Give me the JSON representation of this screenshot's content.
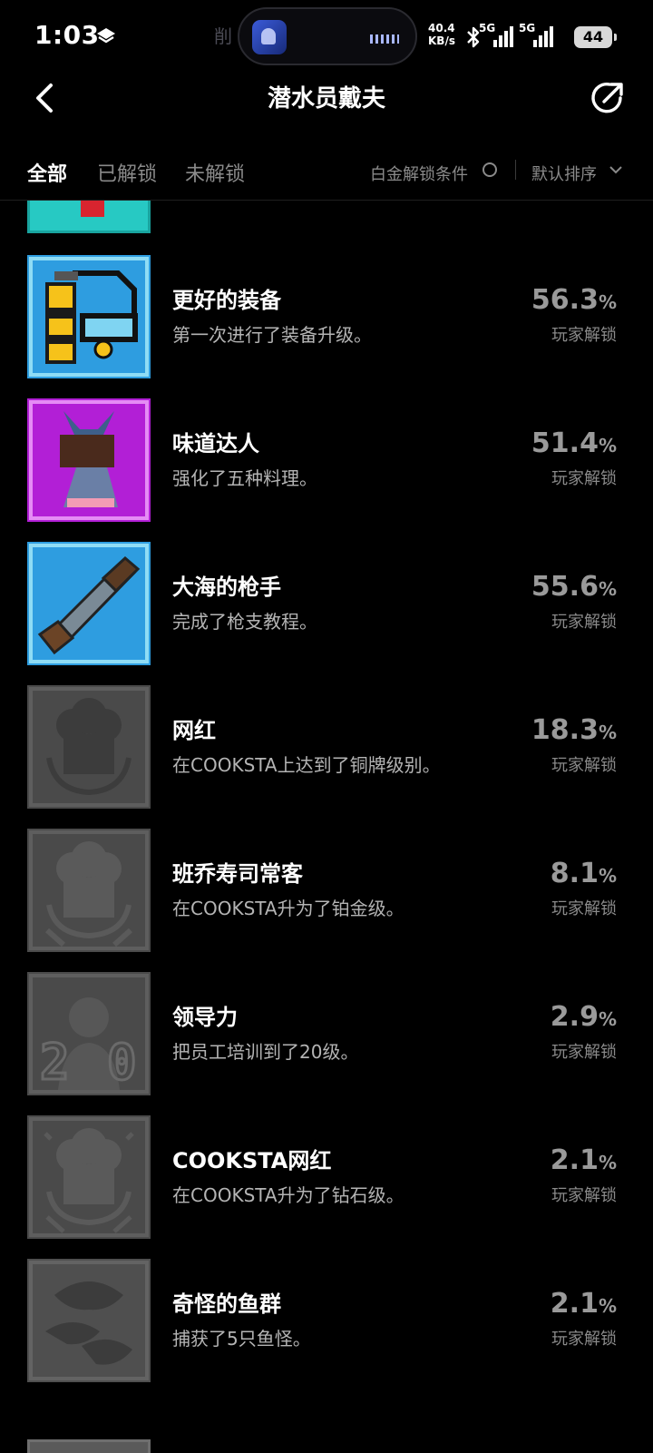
{
  "status_bar": {
    "time": "1:03",
    "net_speed_value": "40.4",
    "net_speed_unit": "KB/s",
    "sim1_label": "5G",
    "sim2_label": "5G",
    "battery": "44",
    "ghost_text": "削"
  },
  "header": {
    "title": "潜水员戴夫",
    "back_icon": "chevron-left-icon",
    "share_icon": "share-icon"
  },
  "tabs": [
    {
      "label": "全部",
      "active": true
    },
    {
      "label": "已解锁",
      "active": false
    },
    {
      "label": "未解锁",
      "active": false
    }
  ],
  "filter": {
    "platinum_condition": "白金解锁条件",
    "sort_label": "默认排序"
  },
  "achievements": [
    {
      "title": "更好的装备",
      "desc": "第一次进行了装备升级。",
      "percent": "56.3",
      "unit": "%",
      "sub": "玩家解锁",
      "unlocked": true,
      "icon": "scuba-gear-icon"
    },
    {
      "title": "味道达人",
      "desc": "强化了五种料理。",
      "percent": "51.4",
      "unit": "%",
      "sub": "玩家解锁",
      "unlocked": true,
      "icon": "sushi-dish-icon"
    },
    {
      "title": "大海的枪手",
      "desc": "完成了枪支教程。",
      "percent": "55.6",
      "unit": "%",
      "sub": "玩家解锁",
      "unlocked": true,
      "icon": "harpoon-gun-icon"
    },
    {
      "title": "网红",
      "desc": "在COOKSTA上达到了铜牌级别。",
      "percent": "18.3",
      "unit": "%",
      "sub": "玩家解锁",
      "unlocked": false,
      "icon": "chef-hat-bronze-icon"
    },
    {
      "title": "班乔寿司常客",
      "desc": "在COOKSTA升为了铂金级。",
      "percent": "8.1",
      "unit": "%",
      "sub": "玩家解锁",
      "unlocked": false,
      "icon": "chef-hat-platinum-icon"
    },
    {
      "title": "领导力",
      "desc": "把员工培训到了20级。",
      "percent": "2.9",
      "unit": "%",
      "sub": "玩家解锁",
      "unlocked": false,
      "icon": "staff-level-20-icon"
    },
    {
      "title": "COOKSTA网红",
      "desc": "在COOKSTA升为了钻石级。",
      "percent": "2.1",
      "unit": "%",
      "sub": "玩家解锁",
      "unlocked": false,
      "icon": "chef-hat-diamond-icon"
    },
    {
      "title": "奇怪的鱼群",
      "desc": "捕获了5只鱼怪。",
      "percent": "2.1",
      "unit": "%",
      "sub": "玩家解锁",
      "unlocked": false,
      "icon": "strange-fish-icon"
    }
  ]
}
